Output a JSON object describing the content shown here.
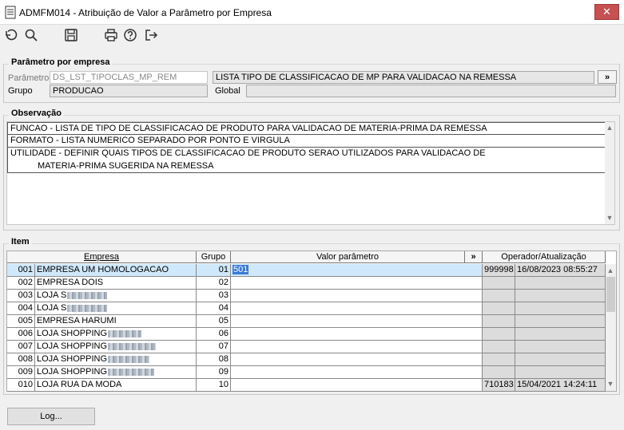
{
  "window": {
    "title": "ADMFM014 - Atribuição de Valor a Parâmetro por Empresa",
    "close_label": "✕"
  },
  "toolbar": {
    "icons": [
      "undo-icon",
      "search-icon",
      "save-icon",
      "print-icon",
      "help-icon",
      "exit-icon"
    ]
  },
  "param_section": {
    "legend": "Parâmetro por empresa",
    "param_label": "Parâmetro",
    "param_code": "DS_LST_TIPOCLAS_MP_REM",
    "param_desc": "LISTA TIPO DE CLASSIFICACAO DE MP PARA VALIDACAO NA REMESSA",
    "more_label": "»",
    "group_label": "Grupo",
    "group_value": "PRODUCAO",
    "global_label": "Global",
    "global_value": ""
  },
  "obs_section": {
    "legend": "Observação",
    "lines": [
      "FUNCAO - LISTA DE TIPO DE CLASSIFICACAO DE PRODUTO PARA VALIDACAO DE MATERIA-PRIMA DA REMESSA",
      "FORMATO - LISTA NUMERICO SEPARADO POR PONTO E VIRGULA",
      "UTILIDADE - DEFINIR QUAIS TIPOS DE CLASSIFICACAO DE PRODUTO SERAO UTILIZADOS PARA VALIDACAO DE",
      "MATERIA-PRIMA SUGERIDA NA REMESSA"
    ]
  },
  "item_section": {
    "legend": "Item",
    "columns": {
      "empresa": "Empresa",
      "grupo": "Grupo",
      "valor": "Valor parâmetro",
      "more": "»",
      "operador": "Operador/Atualização"
    },
    "rows": [
      {
        "code": "001",
        "name": "EMPRESA UM HOMOLOGACAO",
        "grupo": "01",
        "valor": "501",
        "operador": "999998",
        "data": "16/08/2023 08:55:27"
      },
      {
        "code": "002",
        "name": "EMPRESA DOIS",
        "grupo": "02",
        "valor": "",
        "operador": "",
        "data": ""
      },
      {
        "code": "003",
        "name": "LOJA S",
        "grupo": "03",
        "valor": "",
        "operador": "",
        "data": ""
      },
      {
        "code": "004",
        "name": "LOJA S",
        "grupo": "04",
        "valor": "",
        "operador": "",
        "data": ""
      },
      {
        "code": "005",
        "name": "EMPRESA HARUMI",
        "grupo": "05",
        "valor": "",
        "operador": "",
        "data": ""
      },
      {
        "code": "006",
        "name": "LOJA SHOPPING",
        "grupo": "06",
        "valor": "",
        "operador": "",
        "data": ""
      },
      {
        "code": "007",
        "name": "LOJA SHOPPING",
        "grupo": "07",
        "valor": "",
        "operador": "",
        "data": ""
      },
      {
        "code": "008",
        "name": "LOJA SHOPPING",
        "grupo": "08",
        "valor": "",
        "operador": "",
        "data": ""
      },
      {
        "code": "009",
        "name": "LOJA SHOPPING",
        "grupo": "09",
        "valor": "",
        "operador": "",
        "data": ""
      },
      {
        "code": "010",
        "name": "LOJA RUA DA MODA",
        "grupo": "10",
        "valor": "",
        "operador": "710183",
        "data": "15/04/2021 14:24:11"
      }
    ]
  },
  "footer": {
    "log_label": "Log..."
  }
}
